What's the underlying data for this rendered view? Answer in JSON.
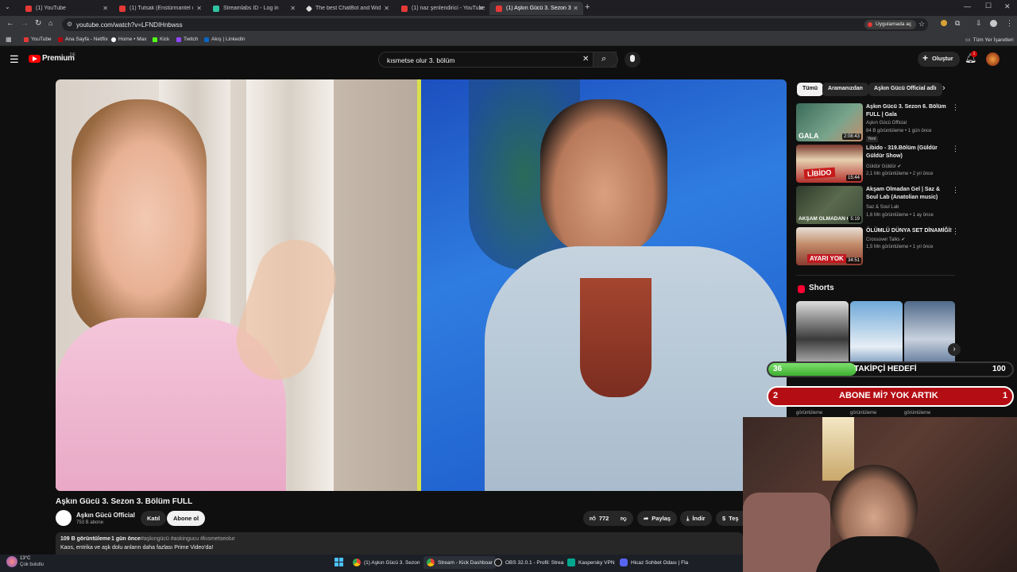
{
  "browser": {
    "tabs": [
      {
        "label": "(1) YouTube",
        "color": "#e53935"
      },
      {
        "label": "(1) Tutsak (Enstürmantel cover)",
        "color": "#e53935"
      },
      {
        "label": "Streamlabs ID - Log in",
        "color": "#31c3a2"
      },
      {
        "label": "The best ChatBot and Widgets",
        "color": "#dddddd"
      },
      {
        "label": "(1) naz şenlendirici - YouTube",
        "color": "#e53935"
      },
      {
        "label": "(1) Aşkın Gücü 3. Sezon 3. B",
        "color": "#e53935"
      }
    ],
    "url": "youtube.com/watch?v=LFNDIHnbwss",
    "open_in_app": "Uygulamada aç",
    "bookmarks": [
      {
        "label": "YouTube",
        "color": "#e53935"
      },
      {
        "label": "Ana Sayfa - Netflix",
        "color": "#b00710"
      },
      {
        "label": "Home • Max",
        "color": "#ffffff"
      },
      {
        "label": "Kick",
        "color": "#53fc18"
      },
      {
        "label": "Twitch",
        "color": "#9146ff"
      },
      {
        "label": "Akış | LinkedIn",
        "color": "#0a66c2"
      }
    ],
    "all_bookmarks": "Tüm Yer İşaretleri"
  },
  "youtube": {
    "logo_text": "Premium",
    "logo_region": "DE",
    "search_value": "kısmetse olur 3. bölüm",
    "create_label": "Oluştur",
    "notif_count": "1",
    "video_title": "Aşkın Gücü 3. Sezon 3. Bölüm FULL",
    "channel_name": "Aşkın Gücü Official",
    "subscribers": "753 B abone",
    "join_label": "Katıl",
    "subscribe_label": "Abone ol",
    "likes": "772",
    "share_label": "Paylaş",
    "download_label": "İndir",
    "more_label": "Teş",
    "desc_views": "109 B görüntüleme",
    "desc_date": "1 gün önce",
    "desc_tags": "#aşkıngücü #askingucu #kısmetseolur",
    "desc_text": "Kaos, entrika ve aşk dolu anların daha fazlası Prime Video'da!",
    "chips": [
      "Tümü",
      "Aramanızdan",
      "Aşkın Gücü Official adlı"
    ],
    "recommendations": [
      {
        "title": "Aşkın Gücü 3. Sezon 6. Bölüm FULL | Gala",
        "channel": "Aşkın Gücü Official",
        "meta": "84 B görüntüleme • 1 gün önce",
        "badge": "Yeni",
        "duration": "2:08:43",
        "thumb_text": "GALA",
        "thumb_color": "#3a6b5a"
      },
      {
        "title": "Libido - 319.Bölüm (Güldür Güldür Show)",
        "channel": "Güldür Güldür",
        "meta": "2,1 Mn görüntüleme • 2 yıl önce",
        "badge": "",
        "duration": "15:44",
        "thumb_text": "LİBİDO",
        "thumb_color": "#b5312d"
      },
      {
        "title": "Akşam Olmadan Gel | Saz & Soul Lab (Anatolian music)",
        "channel": "Saz & Soul Lab",
        "meta": "1,6 Mn görüntüleme • 1 ay önce",
        "badge": "",
        "duration": "5:19",
        "thumb_text": "AKŞAM OLMADAN GEL",
        "thumb_color": "#3c4a3a"
      },
      {
        "title": "ÖLÜMLÜ DÜNYA SET DİNAMİĞİ!",
        "channel": "Crossover Talks",
        "meta": "1,5 Mn görüntüleme • 1 yıl önce",
        "badge": "",
        "duration": "34:51",
        "thumb_text": "AYARI YOK",
        "thumb_color": "#8a3b2f"
      }
    ],
    "shorts_label": "Shorts",
    "shorts_views": [
      "görüntüleme",
      "görüntüleme",
      "görüntüleme"
    ]
  },
  "overlay": {
    "follow_current": "36",
    "follow_label": "TAKİPÇİ HEDEFİ",
    "follow_goal": "100",
    "follow_progress": 0.36,
    "sub_current": "2",
    "sub_label": "ABONE Mİ? YOK ARTIK",
    "sub_goal": "1"
  },
  "taskbar": {
    "weather_temp": "13°C",
    "weather_desc": "Çok bulutlu",
    "items": [
      {
        "label": "(1) Aşkın Gücü 3. Sezon",
        "color": "#4285f4"
      },
      {
        "label": "Stream - Kick Dashboar",
        "color": "#4285f4"
      },
      {
        "label": "OBS 32.0.1 - Profil: Strea",
        "color": "#dddddd"
      },
      {
        "label": "Kaspersky VPN",
        "color": "#00a88e"
      },
      {
        "label": "Hicaz Sohbet Odası | Fla",
        "color": "#5865f2"
      }
    ]
  }
}
